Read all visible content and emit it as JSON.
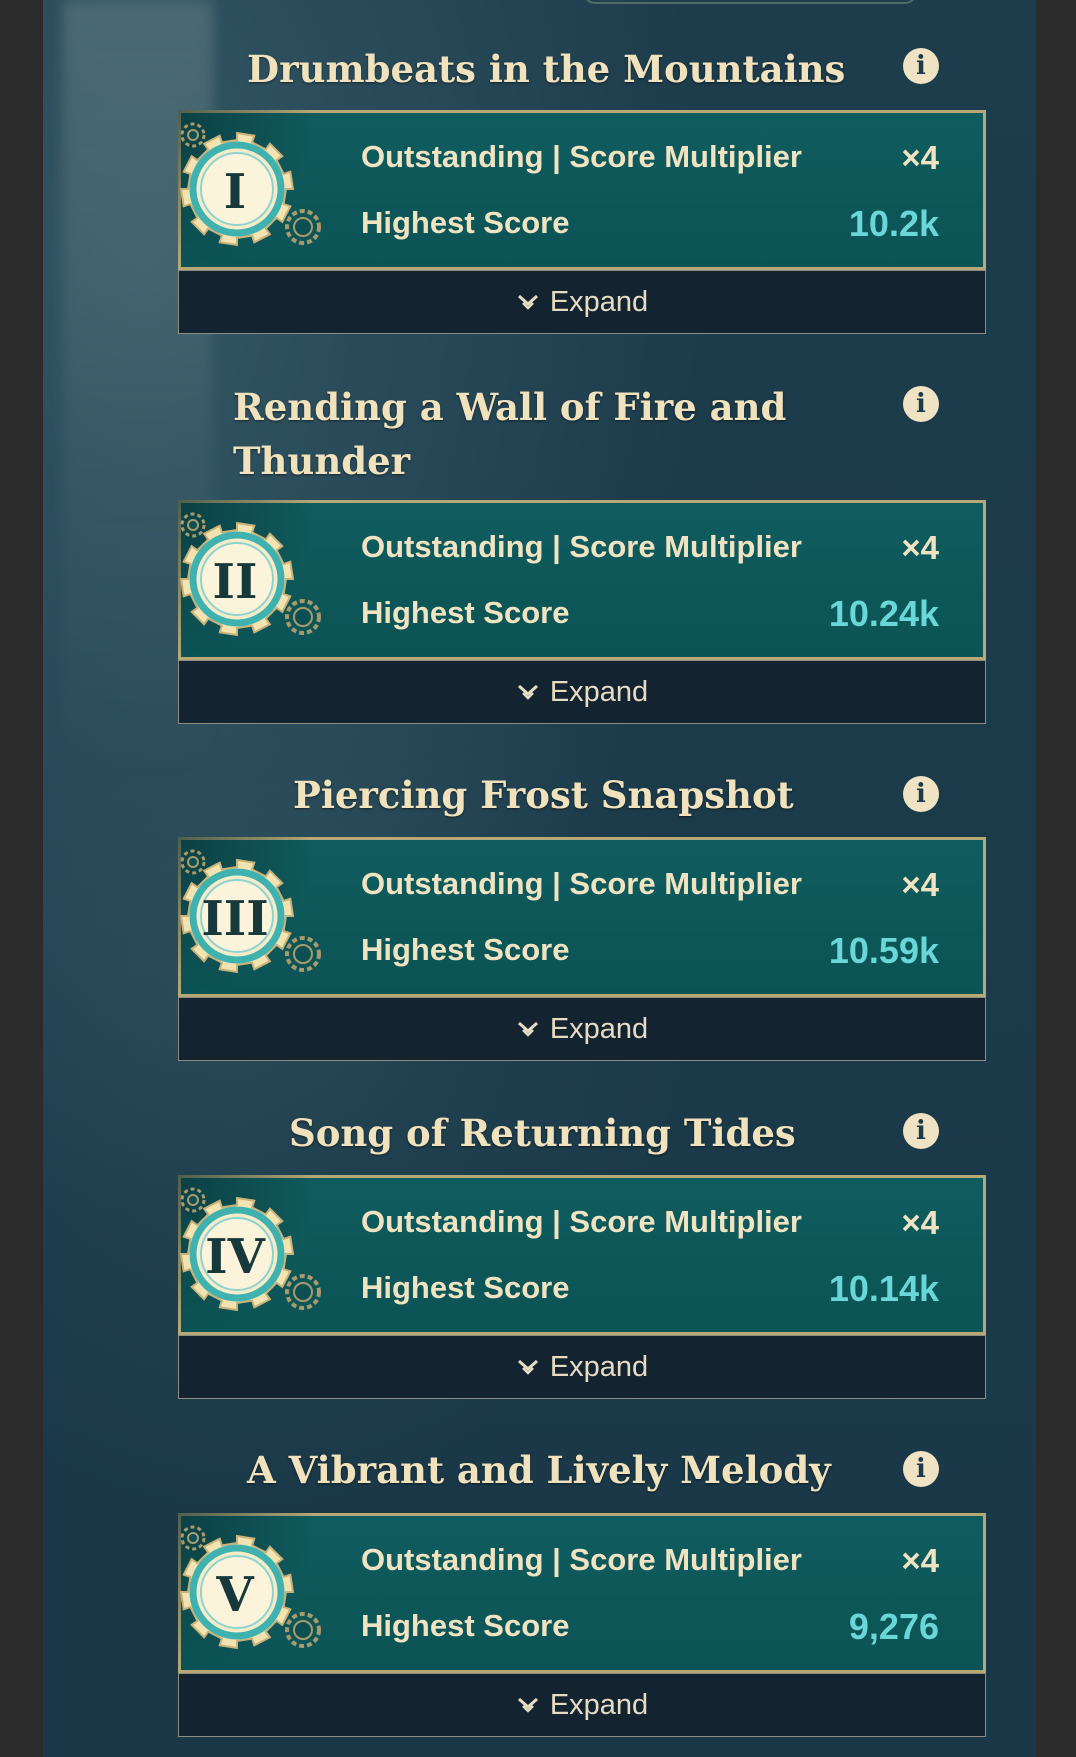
{
  "sections": [
    {
      "title_lines": [
        "Drumbeats in the Mountains"
      ],
      "numeral": "I",
      "rating_label": "Outstanding | Score Multiplier",
      "multiplier": "×4",
      "score_label": "Highest Score",
      "score": "10.2k",
      "expand_label": "Expand"
    },
    {
      "title_lines": [
        "Rending a Wall of Fire and",
        "Thunder"
      ],
      "numeral": "II",
      "rating_label": "Outstanding | Score Multiplier",
      "multiplier": "×4",
      "score_label": "Highest Score",
      "score": "10.24k",
      "expand_label": "Expand"
    },
    {
      "title_lines": [
        "Piercing Frost Snapshot"
      ],
      "numeral": "III",
      "rating_label": "Outstanding | Score Multiplier",
      "multiplier": "×4",
      "score_label": "Highest Score",
      "score": "10.59k",
      "expand_label": "Expand"
    },
    {
      "title_lines": [
        "Song of Returning Tides"
      ],
      "numeral": "IV",
      "rating_label": "Outstanding | Score Multiplier",
      "multiplier": "×4",
      "score_label": "Highest Score",
      "score": "10.14k",
      "expand_label": "Expand"
    },
    {
      "title_lines": [
        "A Vibrant and Lively Melody"
      ],
      "numeral": "V",
      "rating_label": "Outstanding | Score Multiplier",
      "multiplier": "×4",
      "score_label": "Highest Score",
      "score": "9,276",
      "expand_label": "Expand"
    }
  ],
  "icons": {
    "info": "info-icon",
    "expand": "chevron-down-icon",
    "badge": "gear-badge-icon"
  },
  "colors": {
    "background": "#1b3a4a",
    "card": "#0f5c5e",
    "card_border": "#b7a976",
    "title": "#efe2bd",
    "score": "#69d7d6",
    "expand_bar": "#142330"
  }
}
